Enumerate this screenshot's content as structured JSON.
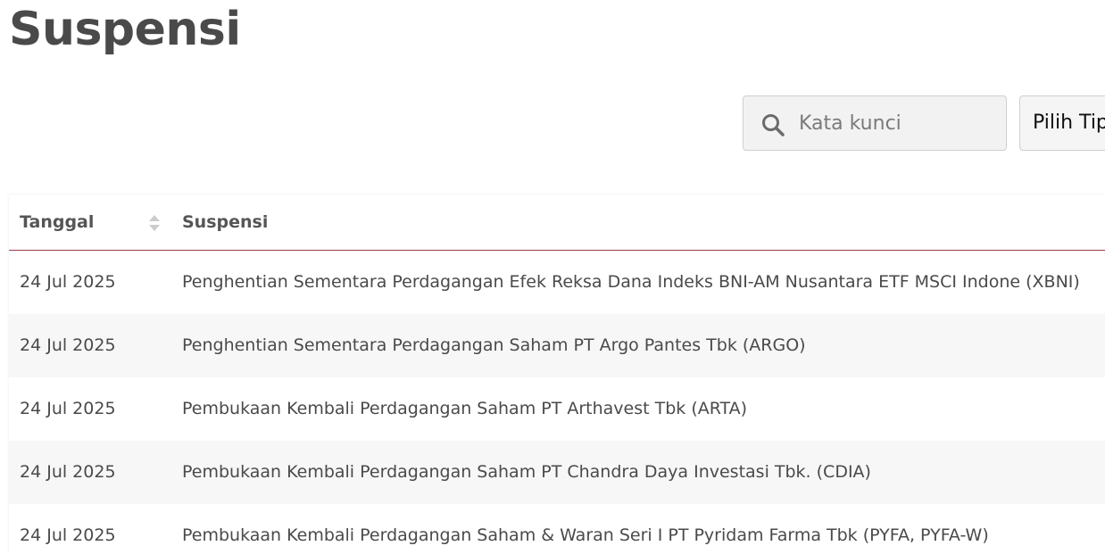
{
  "page": {
    "title": "Suspensi"
  },
  "filters": {
    "search_placeholder": "Kata kunci",
    "type_select_label": "Pilih Tipe"
  },
  "table": {
    "columns": {
      "date": "Tanggal",
      "title": "Suspensi"
    },
    "rows": [
      {
        "date": "24 Jul 2025",
        "title": "Penghentian Sementara Perdagangan Efek Reksa Dana Indeks BNI-AM Nusantara ETF MSCI Indone (XBNI)"
      },
      {
        "date": "24 Jul 2025",
        "title": "Penghentian Sementara Perdagangan Saham PT Argo Pantes Tbk (ARGO)"
      },
      {
        "date": "24 Jul 2025",
        "title": "Pembukaan Kembali Perdagangan Saham PT Arthavest Tbk (ARTA)"
      },
      {
        "date": "24 Jul 2025",
        "title": "Pembukaan Kembali Perdagangan Saham PT Chandra Daya Investasi Tbk. (CDIA)"
      },
      {
        "date": "24 Jul 2025",
        "title": "Pembukaan Kembali Perdagangan Saham & Waran Seri I PT Pyridam Farma Tbk (PYFA, PYFA-W)"
      }
    ]
  },
  "icons": {
    "search": "search-icon",
    "sort": "sort-icon"
  },
  "colors": {
    "header_border": "#9a3c46",
    "row_alt": "#f7f7f7",
    "text": "#4a4a4a"
  }
}
